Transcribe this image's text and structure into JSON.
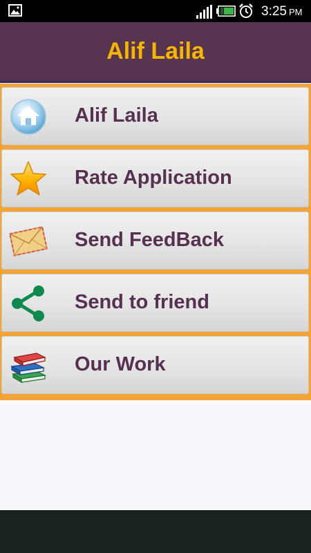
{
  "status_bar": {
    "time": "3:25",
    "ampm": "PM",
    "icons": [
      "gallery-icon",
      "signal-icon",
      "battery-charging-icon",
      "alarm-clock-icon"
    ]
  },
  "header": {
    "title": "Alif Laila"
  },
  "menu": {
    "items": [
      {
        "label": "Alif Laila",
        "icon": "home-icon"
      },
      {
        "label": "Rate Application",
        "icon": "star-icon"
      },
      {
        "label": "Send FeedBack",
        "icon": "envelope-icon"
      },
      {
        "label": "Send to friend",
        "icon": "share-icon"
      },
      {
        "label": "Our Work",
        "icon": "books-icon"
      }
    ]
  },
  "colors": {
    "header_bg": "#573551",
    "title": "#f7b500",
    "menu_frame": "#f4a435",
    "label": "#56304f"
  }
}
